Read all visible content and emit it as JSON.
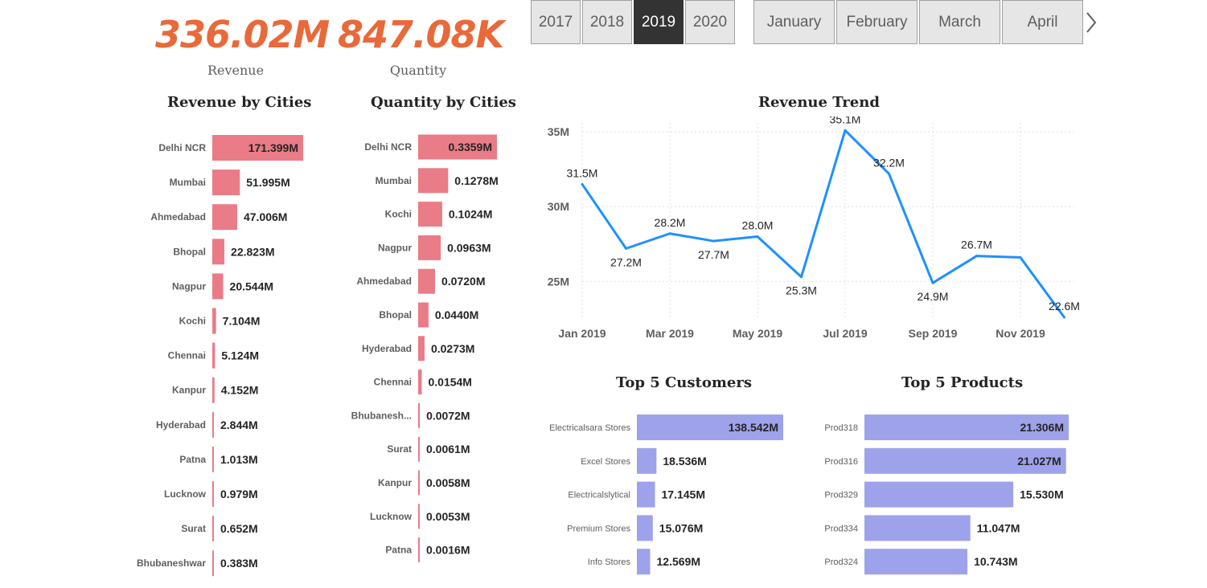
{
  "kpis": [
    {
      "value": "336.02M",
      "label": "Revenue"
    },
    {
      "value": "847.08K",
      "label": "Quantity"
    }
  ],
  "year_slicer": {
    "options": [
      "2017",
      "2018",
      "2019",
      "2020"
    ],
    "selected": "2019"
  },
  "month_slicer": {
    "options": [
      "January",
      "February",
      "March",
      "April"
    ],
    "next_icon": "chevron-right-icon"
  },
  "colors": {
    "accent": "#E8693A",
    "city_bar": "#E97C87",
    "top5_bar": "#9EA2EB",
    "trend_line": "#1E90FF",
    "selected_year": "#333333"
  },
  "chart_data": [
    {
      "id": "revenue_by_cities",
      "type": "bar",
      "orientation": "horizontal",
      "title": "Revenue by Cities",
      "categories": [
        "Delhi NCR",
        "Mumbai",
        "Ahmedabad",
        "Bhopal",
        "Nagpur",
        "Kochi",
        "Chennai",
        "Kanpur",
        "Hyderabad",
        "Patna",
        "Lucknow",
        "Surat",
        "Bhubaneshwar"
      ],
      "values": [
        171.399,
        51.995,
        47.006,
        22.823,
        20.544,
        7.104,
        5.124,
        4.152,
        2.844,
        1.013,
        0.979,
        0.652,
        0.383
      ],
      "labels": [
        "171.399M",
        "51.995M",
        "47.006M",
        "22.823M",
        "20.544M",
        "7.104M",
        "5.124M",
        "4.152M",
        "2.844M",
        "1.013M",
        "0.979M",
        "0.652M",
        "0.383M"
      ]
    },
    {
      "id": "quantity_by_cities",
      "type": "bar",
      "orientation": "horizontal",
      "title": "Quantity by Cities",
      "categories": [
        "Delhi NCR",
        "Mumbai",
        "Kochi",
        "Nagpur",
        "Ahmedabad",
        "Bhopal",
        "Hyderabad",
        "Chennai",
        "Bhubanesh...",
        "Surat",
        "Kanpur",
        "Lucknow",
        "Patna"
      ],
      "values": [
        0.3359,
        0.1278,
        0.1024,
        0.0963,
        0.072,
        0.044,
        0.0273,
        0.0154,
        0.0072,
        0.0061,
        0.0058,
        0.0053,
        0.0016
      ],
      "labels": [
        "0.3359M",
        "0.1278M",
        "0.1024M",
        "0.0963M",
        "0.0720M",
        "0.0440M",
        "0.0273M",
        "0.0154M",
        "0.0072M",
        "0.0061M",
        "0.0058M",
        "0.0053M",
        "0.0016M"
      ]
    },
    {
      "id": "revenue_trend",
      "type": "line",
      "title": "Revenue Trend",
      "x": [
        "Jan 2019",
        "Feb 2019",
        "Mar 2019",
        "Apr 2019",
        "May 2019",
        "Jun 2019",
        "Jul 2019",
        "Aug 2019",
        "Sep 2019",
        "Oct 2019",
        "Nov 2019",
        "Dec 2019"
      ],
      "values": [
        31.5,
        27.2,
        28.2,
        27.7,
        28.0,
        25.3,
        35.1,
        32.2,
        24.9,
        26.7,
        26.6,
        22.6
      ],
      "point_labels": [
        "31.5M",
        "27.2M",
        "28.2M",
        "27.7M",
        "28.0M",
        "25.3M",
        "35.1M",
        "32.2M",
        "24.9M",
        "26.7M",
        null,
        "22.6M"
      ],
      "xticks": [
        "Jan 2019",
        "Mar 2019",
        "May 2019",
        "Jul 2019",
        "Sep 2019",
        "Nov 2019"
      ],
      "yticks": [
        25,
        30,
        35
      ],
      "ytick_labels": [
        "25M",
        "30M",
        "35M"
      ],
      "ylim": [
        22.6,
        35.6
      ],
      "grid": true
    },
    {
      "id": "top5_customers",
      "type": "bar",
      "orientation": "horizontal",
      "title": "Top 5 Customers",
      "categories": [
        "Electricalsara Stores",
        "Excel Stores",
        "Electricalslytical",
        "Premium Stores",
        "Info Stores"
      ],
      "values": [
        138.542,
        18.536,
        17.145,
        15.076,
        12.569
      ],
      "labels": [
        "138.542M",
        "18.536M",
        "17.145M",
        "15.076M",
        "12.569M"
      ]
    },
    {
      "id": "top5_products",
      "type": "bar",
      "orientation": "horizontal",
      "title": "Top 5 Products",
      "categories": [
        "Prod318",
        "Prod316",
        "Prod329",
        "Prod334",
        "Prod324"
      ],
      "values": [
        21.306,
        21.027,
        15.53,
        11.047,
        10.743
      ],
      "labels": [
        "21.306M",
        "21.027M",
        "15.530M",
        "11.047M",
        "10.743M"
      ]
    }
  ]
}
